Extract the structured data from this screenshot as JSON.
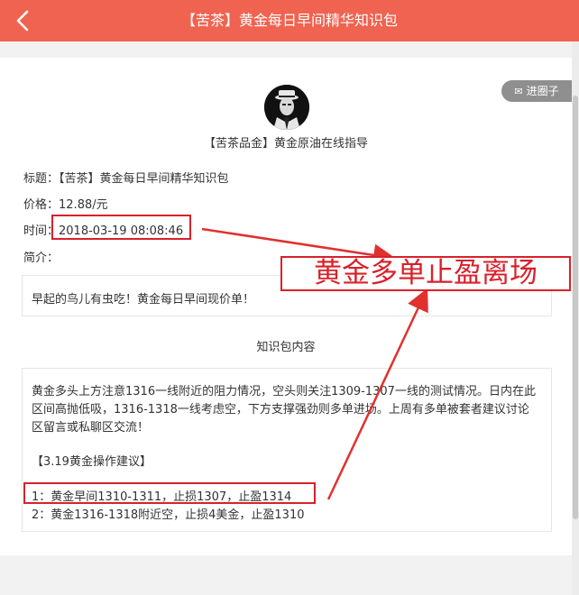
{
  "header": {
    "title": "【苦茶】黄金每日早间精华知识包"
  },
  "join_button": {
    "label": "进圈子",
    "icon": "ticket-icon"
  },
  "group": {
    "name": "【苦茶品金】黄金原油在线指导"
  },
  "fields": {
    "title_label": "标题：",
    "title_value": "【苦茶】黄金每日早间精华知识包",
    "price_label": "价格：",
    "price_value": "12.88/元",
    "time_label": "时间：",
    "time_value": "2018-03-19 08:08:46",
    "intro_label": "简介："
  },
  "intro": {
    "text": "早起的鸟儿有虫吃！黄金每日早间现价单！"
  },
  "section": {
    "title": "知识包内容"
  },
  "content": {
    "paragraph": "黄金多头上方注意1316一线附近的阻力情况，空头则关注1309-1307一线的测试情况。日内在此区间高抛低吸，1316-1318一线考虑空，下方支撑强劲则多单进场。上周有多单被套者建议讨论区留言或私聊区交流！",
    "suggest_title": "【3.19黄金操作建议】",
    "suggest_1": "1：黄金早间1310-1311，止损1307，止盈1314",
    "suggest_2": "2：黄金1316-1318附近空，止损4美金，止盈1310"
  },
  "annotation": {
    "text": "黄金多单止盈离场",
    "color": "#d8212a"
  },
  "colors": {
    "header_bg": "#f06350",
    "annotation_red": "#d8212a"
  }
}
